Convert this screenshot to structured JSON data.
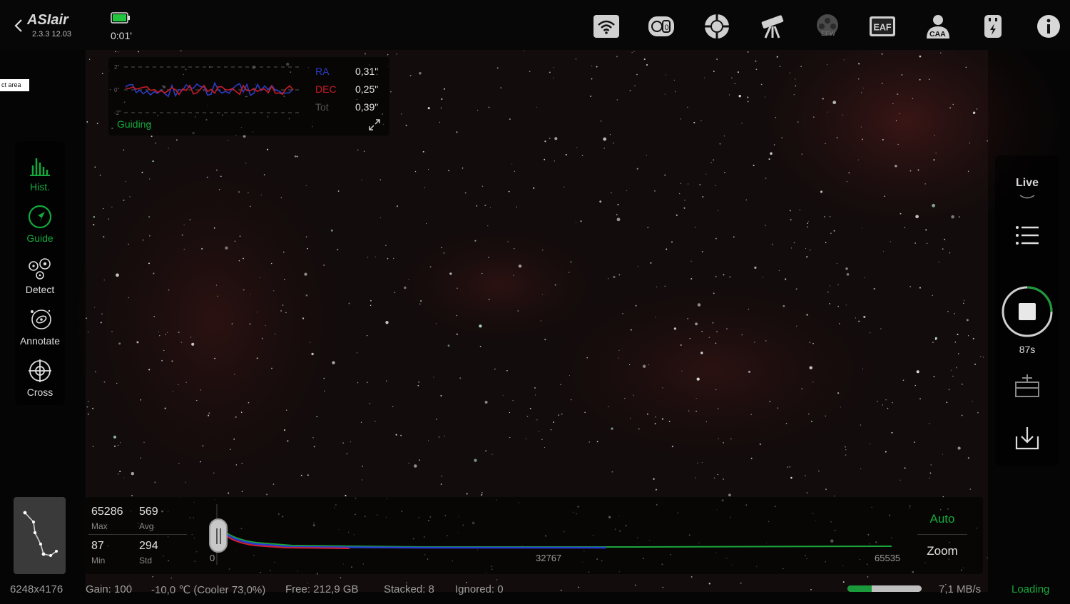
{
  "app": {
    "name": "ASIair",
    "version": "2.3.3 12.03",
    "elapsed": "0:01'"
  },
  "toolbar": {
    "icons": [
      "wifi-icon",
      "camera-icon",
      "guide-scope-icon",
      "telescope-mount-icon",
      "efw-icon",
      "eaf-icon",
      "caa-icon",
      "power-icon",
      "info-icon"
    ],
    "efw_label": "EFW",
    "eaf_label": "EAF",
    "caa_label": "CAA"
  },
  "tooltip": {
    "select_area": "ct area"
  },
  "guiding": {
    "status": "Guiding",
    "axis_labels": [
      "2\"",
      "0\"",
      "-2\""
    ],
    "ra": {
      "label": "RA",
      "value": "0,31\""
    },
    "dec": {
      "label": "DEC",
      "value": "0,25\""
    },
    "tot": {
      "label": "Tot",
      "value": "0,39\""
    },
    "colors": {
      "ra": "#2a3dc2",
      "dec": "#c81c28",
      "status": "#14a93d"
    }
  },
  "left_tools": [
    {
      "label": "Hist.",
      "icon": "histogram-icon",
      "active": true
    },
    {
      "label": "Guide",
      "icon": "guide-icon",
      "active": true
    },
    {
      "label": "Detect",
      "icon": "detect-stars-icon",
      "active": false
    },
    {
      "label": "Annotate",
      "icon": "annotate-icon",
      "active": false
    },
    {
      "label": "Cross",
      "icon": "crosshair-icon",
      "active": false
    }
  ],
  "right_panel": {
    "mode": "Live",
    "timer": "87s"
  },
  "histogram": {
    "max": {
      "value": "65286",
      "label": "Max"
    },
    "avg": {
      "value": "569",
      "label": "Avg"
    },
    "min": {
      "value": "87",
      "label": "Min"
    },
    "std": {
      "value": "294",
      "label": "Std"
    },
    "ticks": [
      "0",
      "32767",
      "65535"
    ],
    "auto_label": "Auto",
    "zoom_label": "Zoom"
  },
  "status": {
    "resolution": "6248x4176",
    "gain": "Gain: 100",
    "temperature": "-10,0 ℃ (Cooler 73,0%)",
    "free": "Free: 212,9 GB",
    "stacked": "Stacked: 8",
    "ignored": "Ignored: 0",
    "speed": "7,1 MB/s",
    "loading": "Loading",
    "progress": 0.33
  },
  "colors": {
    "accent": "#14a93d"
  }
}
